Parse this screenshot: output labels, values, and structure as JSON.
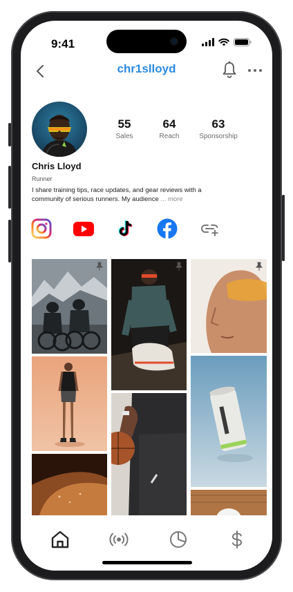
{
  "status_bar": {
    "time": "9:41"
  },
  "header": {
    "handle": "chr1slloyd"
  },
  "profile": {
    "name": "Chris Lloyd",
    "role": "Runner",
    "bio": "I share training tips, race updates, and gear reviews with a community of serious runners. My audience",
    "bio_more": "... more"
  },
  "stats": [
    {
      "value": "55",
      "label": "Sales"
    },
    {
      "value": "64",
      "label": "Reach"
    },
    {
      "value": "63",
      "label": "Sponsorship"
    }
  ],
  "social_links": [
    "instagram-icon",
    "youtube-icon",
    "tiktok-icon",
    "facebook-icon",
    "add-link-icon"
  ],
  "tabs": [
    "home-icon",
    "broadcast-icon",
    "pie-chart-icon",
    "dollar-icon"
  ],
  "colors": {
    "accent": "#2b8ae0",
    "youtube": "#ff0000",
    "facebook": "#1877f2"
  }
}
